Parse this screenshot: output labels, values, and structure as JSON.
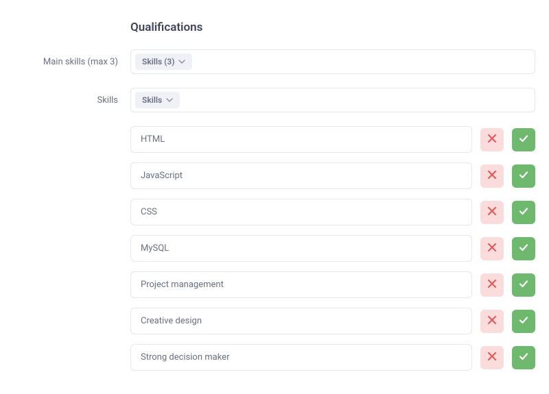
{
  "section": {
    "title": "Qualifications"
  },
  "fields": {
    "main_skills": {
      "label": "Main skills (max 3)",
      "dropdown_label": "Skills (3)"
    },
    "skills": {
      "label": "Skills",
      "dropdown_label": "Skills"
    }
  },
  "skill_entries": [
    {
      "value": "HTML"
    },
    {
      "value": "JavaScript"
    },
    {
      "value": "CSS"
    },
    {
      "value": "MySQL"
    },
    {
      "value": "Project management"
    },
    {
      "value": "Creative design"
    },
    {
      "value": "Strong decision maker"
    }
  ],
  "icons": {
    "chevron_down": "chevron-down-icon",
    "x": "x-icon",
    "check": "check-icon"
  },
  "colors": {
    "reject_bg": "#fbdcdc",
    "reject_fg": "#e25b5b",
    "accept_bg": "#6fb96f",
    "accept_fg": "#ffffff"
  }
}
